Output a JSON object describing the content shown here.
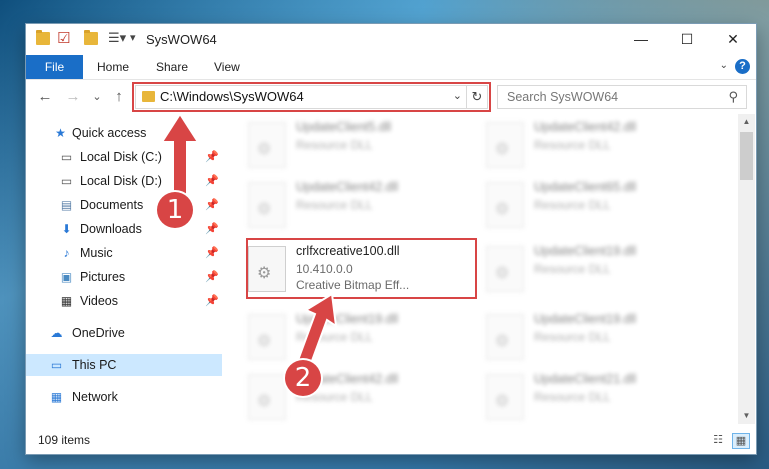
{
  "window": {
    "title": "SysWOW64",
    "controls": {
      "minimize": "—",
      "maximize": "☐",
      "close": "✕"
    }
  },
  "ribbon": {
    "tabs": [
      "File",
      "Home",
      "Share",
      "View"
    ],
    "help": "?"
  },
  "nav": {
    "back": "←",
    "forward": "→",
    "recent": "⌄",
    "up": "↑",
    "address": "C:\\Windows\\SysWOW64",
    "address_dropdown": "⌄",
    "refresh": "↻",
    "search_placeholder": "Search SysWOW64"
  },
  "sidebar": {
    "items": [
      {
        "label": "Quick access",
        "icon": "star-icon",
        "glyph": "★",
        "color": "#2a79d6",
        "pinned": false
      },
      {
        "label": "Local Disk (C:)",
        "icon": "drive-icon",
        "glyph": "▭",
        "color": "#555555",
        "pinned": true
      },
      {
        "label": "Local Disk (D:)",
        "icon": "drive-icon",
        "glyph": "▭",
        "color": "#555555",
        "pinned": true
      },
      {
        "label": "Documents",
        "icon": "documents-icon",
        "glyph": "▤",
        "color": "#5a7fa8",
        "pinned": true
      },
      {
        "label": "Downloads",
        "icon": "download-icon",
        "glyph": "⬇",
        "color": "#2a79d6",
        "pinned": true
      },
      {
        "label": "Music",
        "icon": "music-icon",
        "glyph": "♪",
        "color": "#2a79d6",
        "pinned": true
      },
      {
        "label": "Pictures",
        "icon": "pictures-icon",
        "glyph": "▣",
        "color": "#4a8ac2",
        "pinned": true
      },
      {
        "label": "Videos",
        "icon": "video-icon",
        "glyph": "▦",
        "color": "#333333",
        "pinned": true
      },
      {
        "label": "OneDrive",
        "icon": "cloud-icon",
        "glyph": "☁",
        "color": "#2a79d6",
        "pinned": false
      },
      {
        "label": "This PC",
        "icon": "computer-icon",
        "glyph": "▭",
        "color": "#2a79d6",
        "pinned": false
      },
      {
        "label": "Network",
        "icon": "network-icon",
        "glyph": "▦",
        "color": "#2a79d6",
        "pinned": false
      }
    ],
    "pin_glyph": "📌"
  },
  "files": [
    {
      "name": "UpdateClient5.dll",
      "line1": "Resource DLL",
      "line2": ""
    },
    {
      "name": "UpdateClient42.dll",
      "line1": "Resource DLL",
      "line2": ""
    },
    {
      "name": "UpdateClient42.dll",
      "line1": "Resource DLL",
      "line2": ""
    },
    {
      "name": "UpdateClient65.dll",
      "line1": "Resource DLL",
      "line2": ""
    },
    {
      "name": "crlfxcreative100.dll",
      "line1": "10.410.0.0",
      "line2": "Creative Bitmap Eff..."
    },
    {
      "name": "UpdateClient19.dll",
      "line1": "Resource DLL",
      "line2": ""
    },
    {
      "name": "UpdateClient19.dll",
      "line1": "Resource DLL",
      "line2": ""
    },
    {
      "name": "UpdateClient19.dll",
      "line1": "Resource DLL",
      "line2": ""
    },
    {
      "name": "UpdateClient42.dll",
      "line1": "Resource DLL",
      "line2": ""
    },
    {
      "name": "UpdateClient21.dll",
      "line1": "Resource DLL",
      "line2": ""
    }
  ],
  "status": {
    "item_count": "109 items"
  },
  "annotations": {
    "step1": "1",
    "step2": "2"
  },
  "colors": {
    "accent": "#1a6ec7",
    "highlight": "#d84545",
    "selection": "#cce8ff"
  }
}
